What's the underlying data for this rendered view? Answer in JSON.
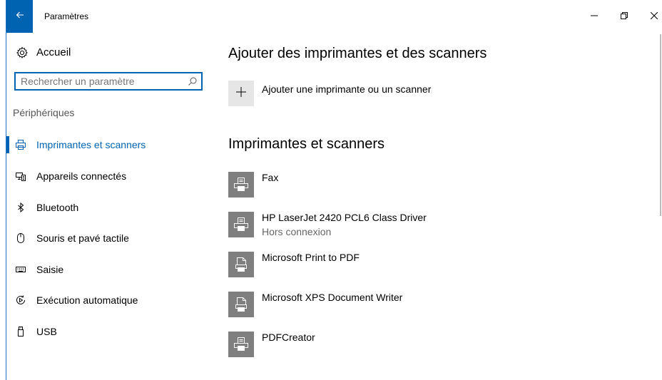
{
  "titlebar": {
    "title": "Paramètres",
    "back_icon": "arrow-left-icon",
    "minimize_icon": "minimize-icon",
    "restore_icon": "restore-icon",
    "close_icon": "close-icon"
  },
  "sidebar": {
    "home": {
      "label": "Accueil",
      "icon": "gear-icon"
    },
    "search": {
      "placeholder": "Rechercher un paramètre",
      "icon": "search-icon"
    },
    "section_label": "Périphériques",
    "items": [
      {
        "label": "Imprimantes et scanners",
        "icon": "printer-icon",
        "active": true
      },
      {
        "label": "Appareils connectés",
        "icon": "connected-devices-icon"
      },
      {
        "label": "Bluetooth",
        "icon": "bluetooth-icon"
      },
      {
        "label": "Souris et pavé tactile",
        "icon": "mouse-icon"
      },
      {
        "label": "Saisie",
        "icon": "keyboard-icon"
      },
      {
        "label": "Exécution automatique",
        "icon": "autoplay-icon"
      },
      {
        "label": "USB",
        "icon": "usb-icon"
      }
    ]
  },
  "main": {
    "add_heading": "Ajouter des imprimantes et des scanners",
    "add_button_label": "Ajouter une imprimante ou un scanner",
    "add_icon": "plus-icon",
    "list_heading": "Imprimantes et scanners",
    "devices": [
      {
        "name": "Fax",
        "status": "",
        "icon": "printer-icon"
      },
      {
        "name": "HP LaserJet 2420 PCL6 Class Driver",
        "status": "Hors connexion",
        "icon": "printer-icon"
      },
      {
        "name": "Microsoft Print to PDF",
        "status": "",
        "icon": "print-to-file-icon"
      },
      {
        "name": "Microsoft XPS Document Writer",
        "status": "",
        "icon": "print-to-file-icon"
      },
      {
        "name": "PDFCreator",
        "status": "",
        "icon": "printer-icon"
      }
    ]
  },
  "colors": {
    "accent": "#0063b1",
    "icon_tile": "#7f7f7f",
    "add_tile": "#e6e6e6"
  }
}
